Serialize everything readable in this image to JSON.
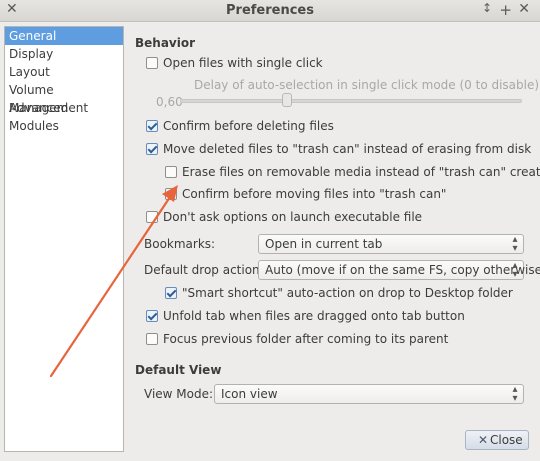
{
  "window": {
    "title": "Preferences",
    "left_close": "✕",
    "right_restore": "↕",
    "right_maximize": "+",
    "right_close": "✕"
  },
  "sidebar": {
    "items": [
      {
        "label": "General",
        "selected": true
      },
      {
        "label": "Display",
        "selected": false
      },
      {
        "label": "Layout",
        "selected": false
      },
      {
        "label": "Volume Management",
        "selected": false
      },
      {
        "label": "Advanced",
        "selected": false
      },
      {
        "label": "Modules",
        "selected": false
      }
    ]
  },
  "behavior": {
    "heading": "Behavior",
    "single_click": {
      "label": "Open files with single click",
      "checked": false
    },
    "delay": {
      "label": "Delay of auto-selection in single click mode (0 to disable)",
      "value_text": "0,60",
      "value": 0.6
    },
    "confirm_delete": {
      "label": "Confirm before deleting files",
      "checked": true
    },
    "move_trash": {
      "label": "Move deleted files to \"trash can\" instead of erasing from disk",
      "checked": true
    },
    "erase_removable": {
      "label": "Erase files on removable media instead of \"trash can\" creation",
      "checked": false
    },
    "confirm_trash": {
      "label": "Confirm before moving files into \"trash can\"",
      "checked": false
    },
    "dont_ask_exec": {
      "label": "Don't ask options on launch executable file",
      "checked": false
    },
    "bookmarks": {
      "label": "Bookmarks:",
      "value": "Open in current tab"
    },
    "drop_action": {
      "label": "Default drop action:",
      "value": "Auto (move if on the same FS, copy otherwise)"
    },
    "smart_shortcut": {
      "label": "\"Smart shortcut\" auto-action on drop to Desktop folder",
      "checked": true
    },
    "unfold_tab": {
      "label": "Unfold tab when files are dragged onto tab button",
      "checked": true
    },
    "focus_previous": {
      "label": "Focus previous folder after coming to its parent",
      "checked": false
    }
  },
  "default_view": {
    "heading": "Default View",
    "view_mode": {
      "label": "View Mode:",
      "value": "Icon view"
    }
  },
  "buttons": {
    "close_label": "Close",
    "close_icon": "✕"
  },
  "annotation": {
    "arrow_color": "#e8643a"
  }
}
